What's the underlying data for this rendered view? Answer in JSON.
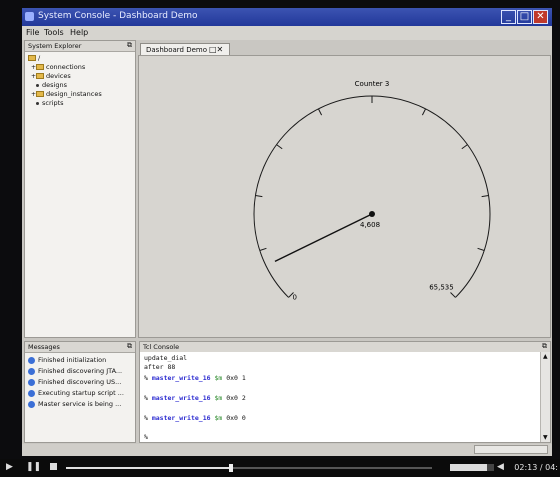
{
  "window": {
    "title": "System Console - Dashboard Demo",
    "minimize": "_",
    "maximize": "□",
    "close": "✕"
  },
  "menu": [
    "File",
    "Tools",
    "Help"
  ],
  "explorer": {
    "title": "System Explorer",
    "root": "/",
    "items": [
      {
        "label": "connections",
        "kind": "folder",
        "expandable": true
      },
      {
        "label": "devices",
        "kind": "folder",
        "expandable": true
      },
      {
        "label": "designs",
        "kind": "leaf",
        "expandable": false
      },
      {
        "label": "design_instances",
        "kind": "folder",
        "expandable": true
      },
      {
        "label": "scripts",
        "kind": "leaf",
        "expandable": false
      }
    ]
  },
  "messages": {
    "title": "Messages",
    "items": [
      "Finished initialization",
      "Finished discovering JTA...",
      "Finished discovering US...",
      "Executing startup script ...",
      "Master service is being ..."
    ]
  },
  "dashboard": {
    "tab_label": "Dashboard Demo",
    "tab_icons": "□✕",
    "gauge": {
      "label": "Counter 3",
      "value": 4608,
      "value_text": "4,608",
      "min": 0,
      "max": 65535,
      "min_text": "0",
      "max_text": "65,535",
      "tick_count": 11
    }
  },
  "console": {
    "title": "Tcl Console",
    "lines": [
      {
        "plain": "update_dial"
      },
      {
        "plain": "after 88"
      },
      {
        "prompt": "% ",
        "cmd": "master_write_16",
        "var": "$m",
        "args": " 0x0 1"
      },
      {
        "plain": ""
      },
      {
        "prompt": "% ",
        "cmd": "master_write_16",
        "var": "$m",
        "args": " 0x0 2"
      },
      {
        "plain": ""
      },
      {
        "prompt": "% ",
        "cmd": "master_write_16",
        "var": "$m",
        "args": " 0x0 0"
      },
      {
        "plain": ""
      },
      {
        "plain": "%"
      }
    ]
  },
  "player": {
    "time": "02:13 / 04:",
    "progress": 0.45,
    "volume": 0.85
  },
  "colors": {
    "titlebar": "#22389a",
    "accent": "#3b6fd6",
    "needle": "#111111"
  }
}
